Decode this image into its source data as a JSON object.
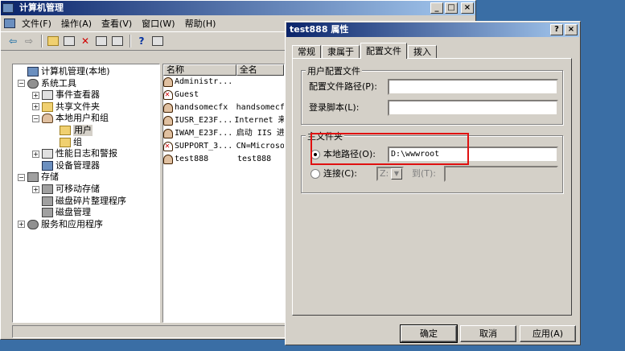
{
  "main_window": {
    "title": "计算机管理",
    "menu": [
      "文件(F)",
      "操作(A)",
      "查看(V)",
      "窗口(W)",
      "帮助(H)"
    ]
  },
  "tree": [
    {
      "label": "计算机管理(本地)",
      "icon": "computer-icon",
      "expander": ""
    },
    {
      "label": "系统工具",
      "icon": "tools-icon",
      "expander": "−"
    },
    {
      "label": "事件查看器",
      "icon": "event-viewer-icon",
      "expander": "+"
    },
    {
      "label": "共享文件夹",
      "icon": "shared-folder-icon",
      "expander": "+"
    },
    {
      "label": "本地用户和组",
      "icon": "users-icon",
      "expander": "−"
    },
    {
      "label": "用户",
      "icon": "folder-open-icon",
      "expander": ""
    },
    {
      "label": "组",
      "icon": "folder-icon",
      "expander": ""
    },
    {
      "label": "性能日志和警报",
      "icon": "perf-icon",
      "expander": "+"
    },
    {
      "label": "设备管理器",
      "icon": "device-manager-icon",
      "expander": ""
    },
    {
      "label": "存储",
      "icon": "storage-icon",
      "expander": "−"
    },
    {
      "label": "可移动存储",
      "icon": "removable-storage-icon",
      "expander": "+"
    },
    {
      "label": "磁盘碎片整理程序",
      "icon": "defrag-icon",
      "expander": ""
    },
    {
      "label": "磁盘管理",
      "icon": "disk-mgmt-icon",
      "expander": ""
    },
    {
      "label": "服务和应用程序",
      "icon": "services-icon",
      "expander": "+"
    }
  ],
  "list": {
    "headers": [
      "名称",
      "全名"
    ],
    "rows": [
      {
        "name": "Administr...",
        "full": "",
        "disabled": false
      },
      {
        "name": "Guest",
        "full": "",
        "disabled": true
      },
      {
        "name": "handsomecfx",
        "full": "handsomecf",
        "disabled": false
      },
      {
        "name": "IUSR_E23F...",
        "full": "Internet 来",
        "disabled": false
      },
      {
        "name": "IWAM_E23F...",
        "full": "启动 IIS 进",
        "disabled": false
      },
      {
        "name": "SUPPORT_3...",
        "full": "CN=Microso",
        "disabled": true
      },
      {
        "name": "test888",
        "full": "test888",
        "disabled": false
      }
    ]
  },
  "dialog": {
    "title": "test888 属性",
    "tabs": [
      "常规",
      "隶属于",
      "配置文件",
      "拨入"
    ],
    "active_tab": "配置文件",
    "profile_group": "用户配置文件",
    "profile_path_label": "配置文件路径(P):",
    "profile_path_value": "",
    "logon_script_label": "登录脚本(L):",
    "logon_script_value": "",
    "home_group": "主文件夹",
    "local_path_label": "本地路径(O):",
    "local_path_value": "D:\\wwwroot",
    "connect_label": "连接(C):",
    "drive_value": "Z:",
    "to_label": "到(T):",
    "to_value": "",
    "ok": "确定",
    "cancel": "取消",
    "apply": "应用(A)"
  },
  "colors": {
    "desktop": "#3a6ea5",
    "title_active": "#0a246a",
    "highlight_box": "#e01010"
  }
}
